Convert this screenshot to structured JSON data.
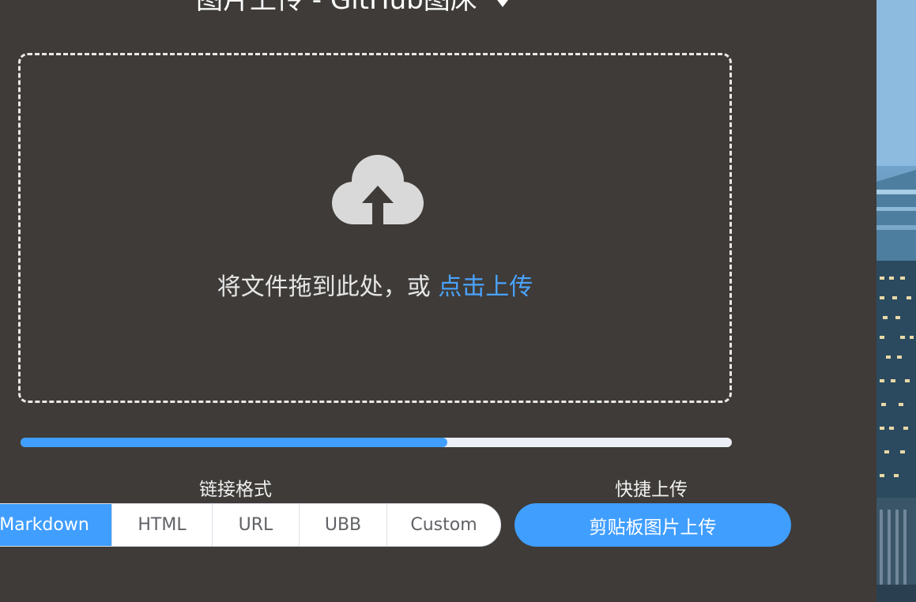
{
  "header": {
    "title": "图片上传 - GitHub图床"
  },
  "dropzone": {
    "prompt_text": "将文件拖到此处，或 ",
    "link_text": "点击上传",
    "icon": "cloud-upload-icon"
  },
  "progress": {
    "percent": 60
  },
  "link_format": {
    "label": "链接格式",
    "options": [
      "Markdown",
      "HTML",
      "URL",
      "UBB",
      "Custom"
    ],
    "selected": "Markdown"
  },
  "quick_upload": {
    "label": "快捷上传",
    "button_label": "剪贴板图片上传"
  },
  "colors": {
    "background": "#3e3b38",
    "accent": "#409eff",
    "link": "#4aa3ff"
  }
}
